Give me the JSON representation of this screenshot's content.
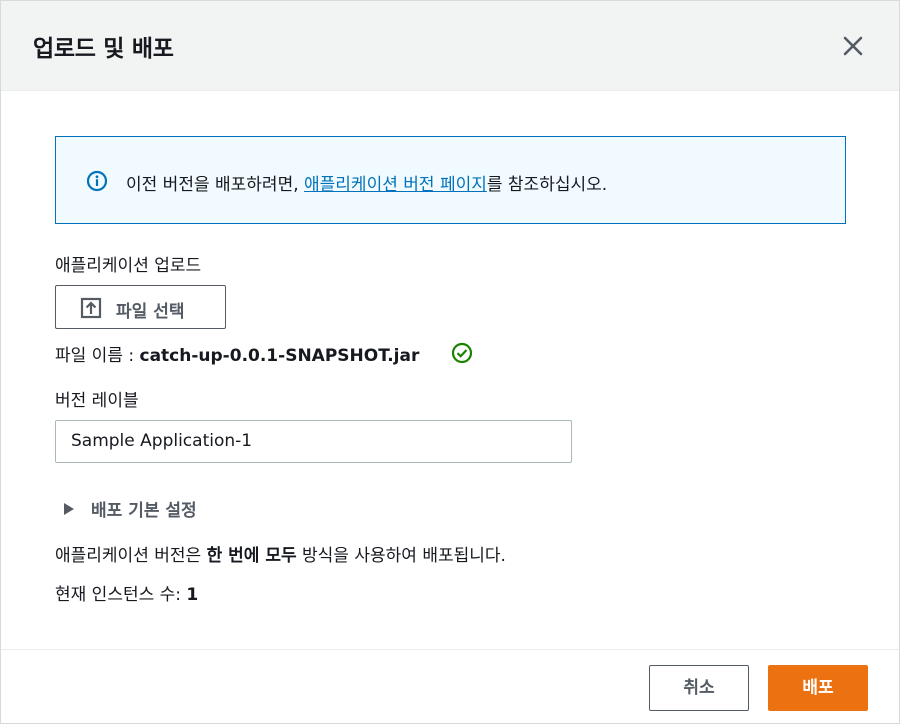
{
  "modal": {
    "title": "업로드 및 배포"
  },
  "info": {
    "text_before": "이전 버전을 배포하려면, ",
    "link_text": "애플리케이션 버전 페이지",
    "text_after": "를 참조하십시오."
  },
  "upload": {
    "label": "애플리케이션 업로드",
    "choose_file_label": "파일 선택",
    "filename_prefix": "파일 이름 : ",
    "filename": "catch-up-0.0.1-SNAPSHOT.jar"
  },
  "version_label": {
    "label": "버전 레이블",
    "value": "Sample Application-1"
  },
  "deploy_settings": {
    "label": "배포 기본 설정",
    "desc_before": "애플리케이션 버전은 ",
    "desc_bold": "한 번에 모두",
    "desc_after": " 방식을 사용하여 배포됩니다.",
    "instances_label": "현재 인스턴스 수: ",
    "instances_value": "1"
  },
  "footer": {
    "cancel_label": "취소",
    "deploy_label": "배포"
  },
  "colors": {
    "primary": "#ec7211",
    "link": "#0073bb",
    "success": "#1d8102",
    "header_bg": "#f2f3f3",
    "info_bg": "#f1faff"
  },
  "icons": {
    "close": "close-icon",
    "info": "info-icon",
    "upload": "upload-icon",
    "check": "check-circle-icon",
    "caret": "caret-right-icon"
  }
}
